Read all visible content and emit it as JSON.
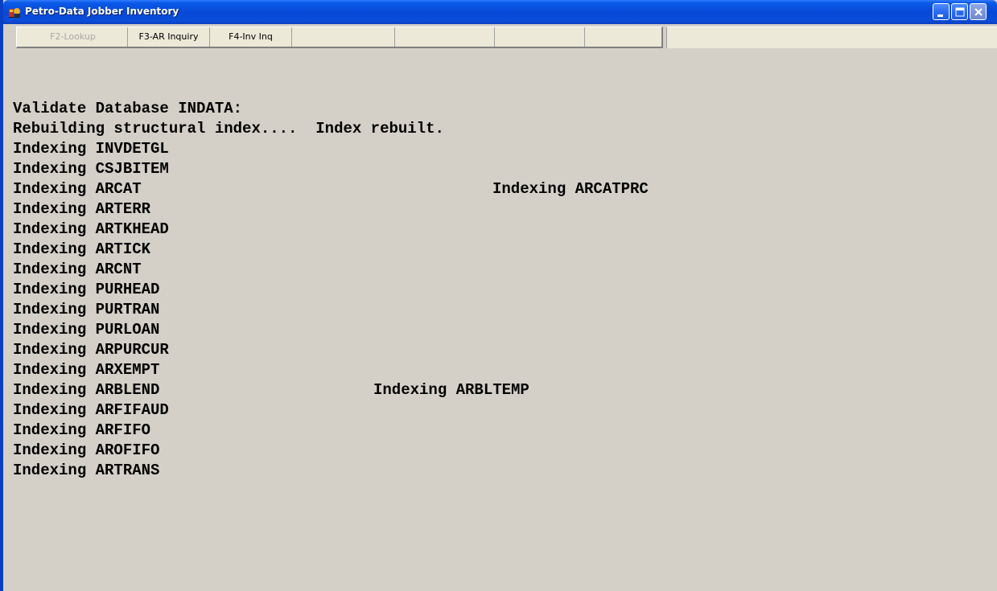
{
  "window": {
    "title": "Petro-Data Jobber Inventory",
    "icon": "petro-data-app-icon",
    "controls": [
      "minimize-icon",
      "maximize-icon",
      "close-icon"
    ],
    "titlebar_color": "#0a4ed8",
    "background_color": "#d4d0c8"
  },
  "toolbar": {
    "buttons": [
      {
        "label": "F2-Lookup",
        "enabled": false
      },
      {
        "label": "F3-AR Inquiry",
        "enabled": true
      },
      {
        "label": "F4-Inv Inq",
        "enabled": true
      },
      {
        "label": "",
        "enabled": true
      },
      {
        "label": "",
        "enabled": true
      },
      {
        "label": "",
        "enabled": true
      }
    ]
  },
  "console": {
    "lines": [
      "Validate Database INDATA:",
      "Rebuilding structural index....  Index rebuilt.",
      "Indexing INVDETGL",
      "Indexing CSJBITEM",
      "Indexing ARCAT",
      "Indexing ARTERR",
      "Indexing ARTKHEAD",
      "Indexing ARTICK",
      "Indexing ARCNT",
      "Indexing PURHEAD",
      "Indexing PURTRAN",
      "Indexing PURLOAN",
      "Indexing ARPURCUR",
      "Indexing ARXEMPT",
      "Indexing ARBLEND",
      "Indexing ARFIFAUD",
      "Indexing ARFIFO",
      "Indexing AROFIFO",
      "Indexing ARTRANS"
    ],
    "overlay_texts": [
      "Indexing ARCATPRC",
      "Indexing ARBLTEMP"
    ]
  }
}
